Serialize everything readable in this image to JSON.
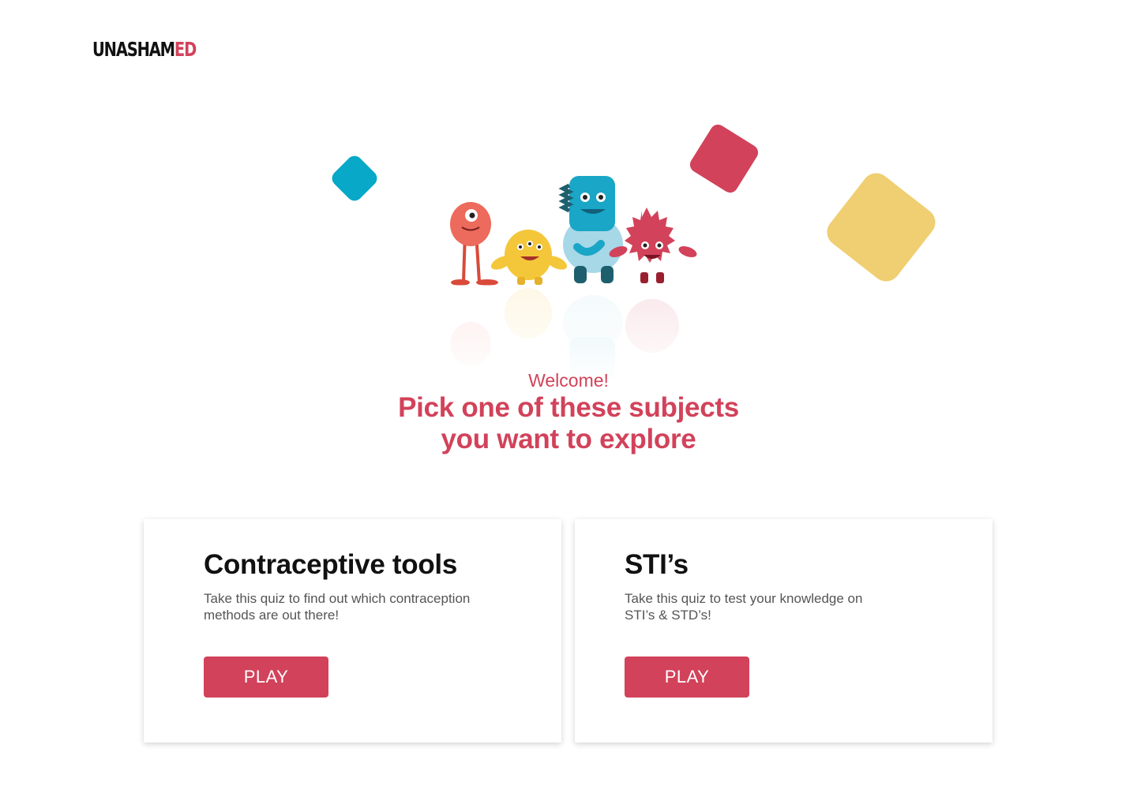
{
  "brand": {
    "logo_main": "UNASHAM",
    "logo_accent": "ED"
  },
  "colors": {
    "accent": "#d2425a",
    "blue_shape": "#07a8c8",
    "red_shape": "#d2425a",
    "yellow_shape": "#f0ce72"
  },
  "hero": {
    "welcome": "Welcome!",
    "headline_line1": "Pick one of these subjects",
    "headline_line2": "you want to explore"
  },
  "cards": [
    {
      "title": "Contraceptive tools",
      "description": "Take this quiz to find out which contraception methods are out there!",
      "button_label": "PLAY"
    },
    {
      "title": "STI’s",
      "description": "Take this quiz to test your knowledge on STI’s & STD’s!",
      "button_label": "PLAY"
    }
  ]
}
